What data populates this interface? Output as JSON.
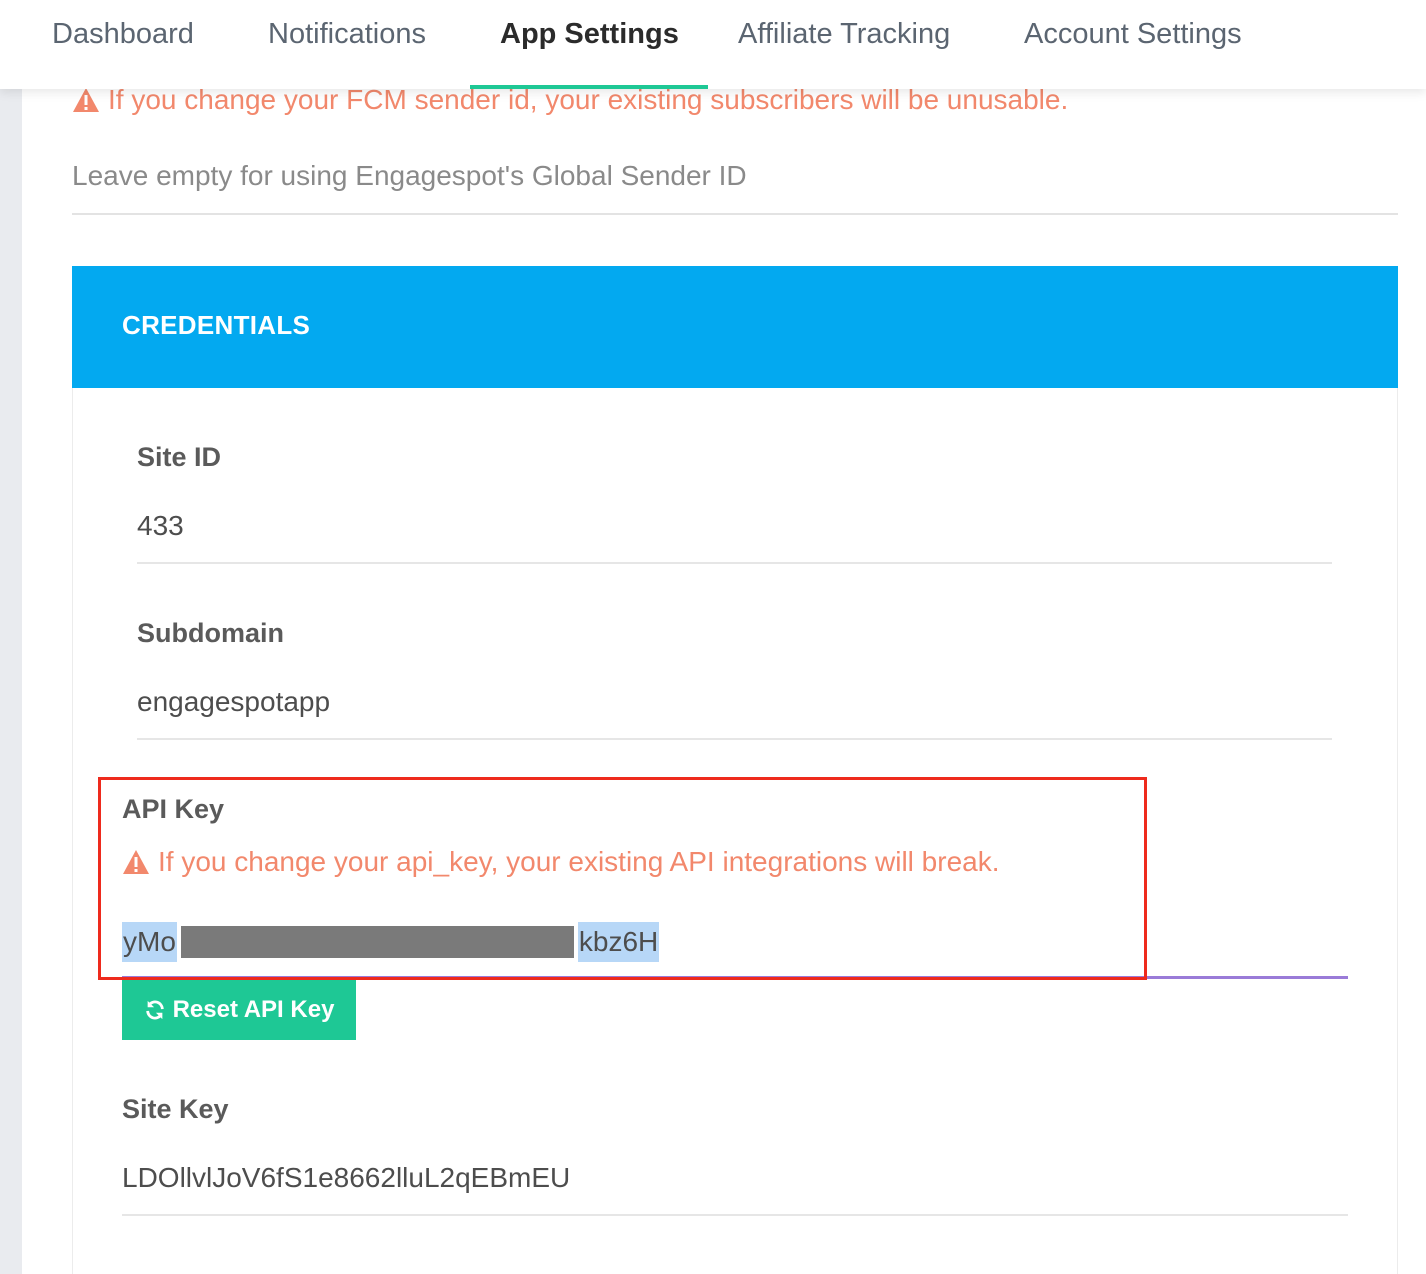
{
  "nav": {
    "tabs": [
      {
        "label": "Dashboard"
      },
      {
        "label": "Notifications"
      },
      {
        "label": "App Settings"
      },
      {
        "label": "Affiliate Tracking"
      },
      {
        "label": "Account Settings"
      }
    ],
    "active_tab": "App Settings"
  },
  "fcm": {
    "warning_icon": "warning-triangle-icon",
    "warning_text": "If you change your FCM sender id, your existing subscribers will be unusable.",
    "sender_id_placeholder": "Leave empty for using Engagespot's Global Sender ID"
  },
  "credentials": {
    "title": "CREDENTIALS",
    "site_id": {
      "label": "Site ID",
      "value": "433"
    },
    "subdomain": {
      "label": "Subdomain",
      "value": "engagespotapp"
    },
    "api_key": {
      "label": "API Key",
      "warning_text": "If you change your api_key, your existing API integrations will break.",
      "value_prefix": "yMo",
      "value_suffix": "kbz6H",
      "reset_button_label": "Reset API Key",
      "reset_icon": "refresh-icon"
    },
    "site_key": {
      "label": "Site Key",
      "value": "LDOllvlJoV6fS1e8662lluL2qEBmEU"
    }
  },
  "colors": {
    "accent_blue": "#03a9f0",
    "accent_green": "#1ec895",
    "warning_orange": "#f2886c",
    "highlight_red": "#ee2a1d",
    "selection_blue": "#b7d7f7"
  }
}
